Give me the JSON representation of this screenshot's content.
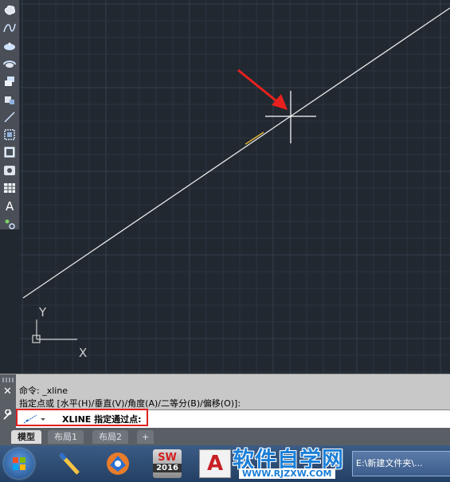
{
  "toolbar": {
    "tools": [
      "revision-cloud-icon",
      "spline-icon",
      "ellipse-icon",
      "ellipse-arc-icon",
      "insert-block-icon",
      "make-block-icon",
      "point-icon",
      "hatch-icon",
      "gradient-icon",
      "region-icon",
      "table-icon",
      "multiline-text-icon",
      "add-selected-icon"
    ]
  },
  "canvas": {
    "background": "#212830",
    "grid_color": "#2d3540",
    "line_color": "#e8e8e8",
    "highlight_color": "#e0b030",
    "arrow_color": "#e8211f",
    "ucs": {
      "y_label": "Y",
      "x_label": "X"
    }
  },
  "command": {
    "history": [
      "命令: _xline",
      "指定点或 [水平(H)/垂直(V)/角度(A)/二等分(B)/偏移(O)]:"
    ],
    "prompt": "XLINE 指定通过点:",
    "close_label": "✕"
  },
  "tabs": [
    {
      "label": "模型",
      "active": true
    },
    {
      "label": "布局1",
      "active": false
    },
    {
      "label": "布局2",
      "active": false
    },
    {
      "label": "+",
      "active": false
    }
  ],
  "taskbar": {
    "explorer_label": "E:\\新建文件夹\\...",
    "sw_year": "2016",
    "sw_label": "SW",
    "autocad_label": "A"
  },
  "watermark": {
    "main": "软件自学网",
    "url": "WWW.RJZXW.COM"
  }
}
